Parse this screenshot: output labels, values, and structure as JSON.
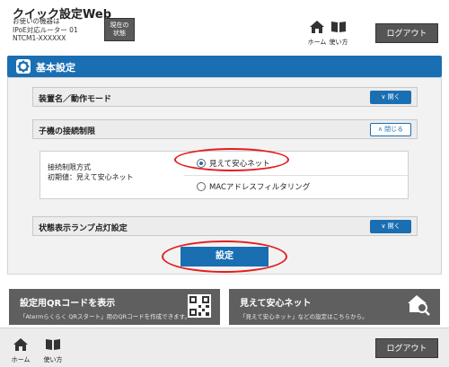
{
  "header": {
    "app_title": "クイック設定Web",
    "device_line1": "お使いの機器は",
    "device_line2": "IPoE対応ルーター 01",
    "device_line3": "NTCM1-XXXXXX",
    "status_line1": "現在の",
    "status_line2": "状態",
    "home_label": "ホーム",
    "help_label": "使い方",
    "logout_label": "ログアウト"
  },
  "section": {
    "title": "基本設定"
  },
  "accordions": {
    "device_mode": {
      "label": "装置名／動作モード",
      "toggle": "開く"
    },
    "child_restrict": {
      "label": "子機の接続制限",
      "toggle": "閉じる"
    },
    "lamp_setting": {
      "label": "状態表示ランプ点灯設定",
      "toggle": "開く"
    }
  },
  "restrict_method": {
    "label_line1": "接続制限方式",
    "label_line2": "初期値：見えて安心ネット",
    "options": [
      {
        "label": "見えて安心ネット",
        "selected": true
      },
      {
        "label": "MACアドレスフィルタリング",
        "selected": false
      }
    ]
  },
  "set_button": "設定",
  "banners": {
    "qr": {
      "title": "設定用QRコードを表示",
      "sub": "「Atermらくらく QRスタート」用のQRコードを作成できます。"
    },
    "mieru": {
      "title": "見えて安心ネット",
      "sub": "「見えて安心ネット」などの設定はこちらから。"
    }
  },
  "footer": {
    "home_label": "ホーム",
    "help_label": "使い方",
    "logout_label": "ログアウト"
  },
  "colors": {
    "accent": "#1a6fb3",
    "highlight": "#e31e1e",
    "banner": "#5f5f5f"
  }
}
